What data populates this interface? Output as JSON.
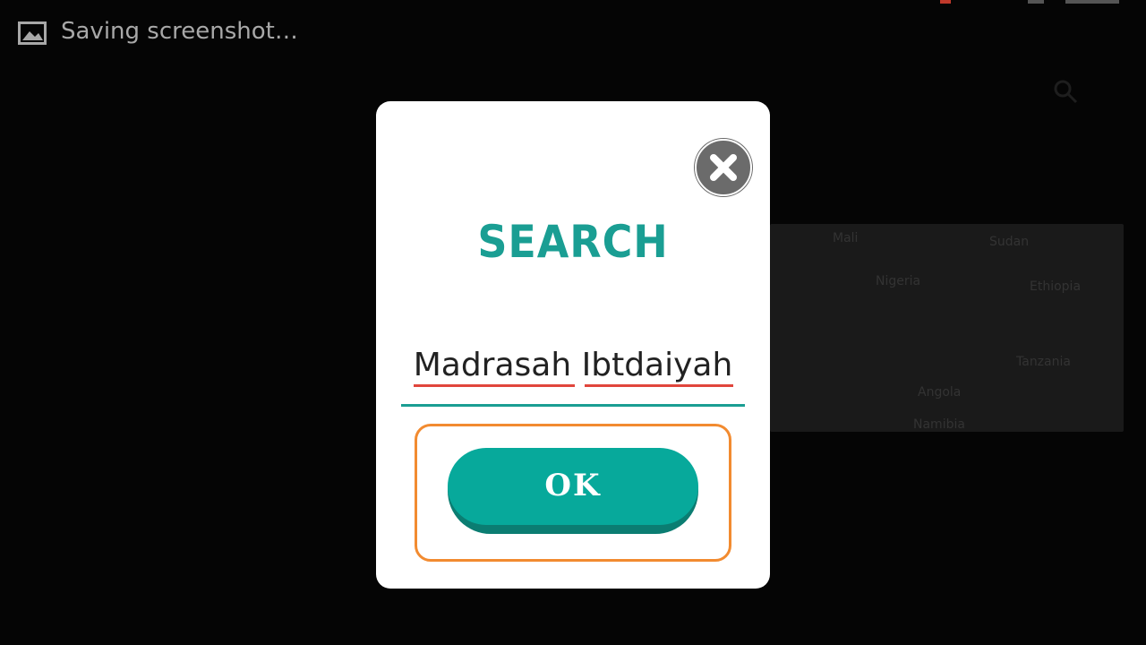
{
  "notification": {
    "text": "Saving screenshot…",
    "icon": "image-icon"
  },
  "background": {
    "map_labels": [
      "Mali",
      "Sudan",
      "Nigeria",
      "Ethiopia",
      "Tanzania",
      "Angola",
      "Namibia"
    ],
    "search_icon": "search-icon"
  },
  "dialog": {
    "title": "SEARCH",
    "search_value": "Madrasah Ibtdaiyah",
    "ok_label": "OK",
    "close_icon": "close-icon"
  },
  "colors": {
    "accent": "#07a99b",
    "accent_dark": "#0b7d72",
    "title": "#1a9e93",
    "highlight": "#f28b30",
    "close_bg": "#6b6b6b",
    "spellcheck": "#e0453c"
  }
}
